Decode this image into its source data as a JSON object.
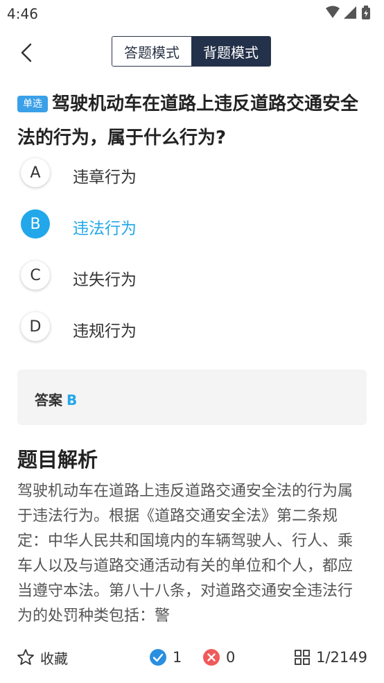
{
  "status_bar": {
    "time": "4:46"
  },
  "header": {
    "modes": [
      {
        "label": "答题模式",
        "active": false
      },
      {
        "label": "背题模式",
        "active": true
      }
    ]
  },
  "question": {
    "type_tag": "单选",
    "text": "驾驶机动车在道路上违反道路交通安全法的行为，属于什么行为?"
  },
  "options": [
    {
      "letter": "A",
      "text": "违章行为",
      "selected": false
    },
    {
      "letter": "B",
      "text": "违法行为",
      "selected": true
    },
    {
      "letter": "C",
      "text": "过失行为",
      "selected": false
    },
    {
      "letter": "D",
      "text": "违规行为",
      "selected": false
    }
  ],
  "answer": {
    "label": "答案",
    "value": "B"
  },
  "analysis": {
    "title": "题目解析",
    "text": "驾驶机动车在道路上违反道路交通安全法的行为属于违法行为。根据《道路交通安全法》第二条规定：中华人民共和国境内的车辆驾驶人、行人、乘车人以及与道路交通活动有关的单位和个人，都应当遵守本法。第八十八条，对道路交通安全违法行为的处罚种类包括：警"
  },
  "bottom_bar": {
    "favorite_label": "收藏",
    "correct_count": "1",
    "wrong_count": "0",
    "progress": "1/2149"
  },
  "colors": {
    "accent": "#22a7ea",
    "dark": "#24314a",
    "correct": "#2a8fe0",
    "wrong": "#ef5a5a"
  }
}
